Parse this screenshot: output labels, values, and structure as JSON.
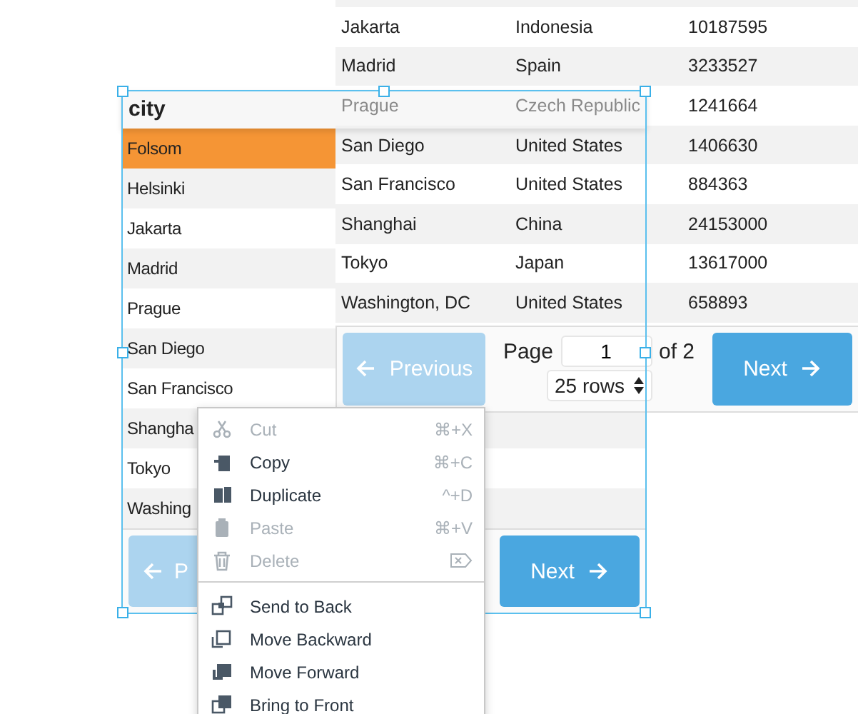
{
  "background_table": {
    "rows": [
      {
        "city": "Jakarta",
        "country": "Indonesia",
        "population": "10187595"
      },
      {
        "city": "Madrid",
        "country": "Spain",
        "population": "3233527"
      },
      {
        "city": "Prague",
        "country": "Czech Republic",
        "population": "1241664"
      },
      {
        "city": "San Diego",
        "country": "United States",
        "population": "1406630"
      },
      {
        "city": "San Francisco",
        "country": "United States",
        "population": "884363"
      },
      {
        "city": "Shanghai",
        "country": "China",
        "population": "24153000"
      },
      {
        "city": "Tokyo",
        "country": "Japan",
        "population": "13617000"
      },
      {
        "city": "Washington, DC",
        "country": "United States",
        "population": "658893"
      }
    ],
    "pagination": {
      "previous": {
        "label": "Previous",
        "disabled": true
      },
      "page_label": "Page",
      "page": "1",
      "of_label": "of 2",
      "rows_select": "25 rows",
      "next": {
        "label": "Next",
        "disabled": false
      }
    }
  },
  "dragged_table": {
    "header": "city",
    "rows": [
      {
        "city": "Folsom",
        "selected": true
      },
      {
        "city": "Helsinki",
        "selected": false
      },
      {
        "city": "Jakarta",
        "selected": false
      },
      {
        "city": "Madrid",
        "selected": false
      },
      {
        "city": "Prague",
        "selected": false
      },
      {
        "city": "San Diego",
        "selected": false
      },
      {
        "city": "San Francisco",
        "selected": false
      },
      {
        "city": "Shangha",
        "selected": false
      },
      {
        "city": "Tokyo",
        "selected": false
      },
      {
        "city": "Washing",
        "selected": false
      }
    ],
    "pagination": {
      "previous": {
        "label": "P",
        "disabled": true
      },
      "next": {
        "label": "Next",
        "disabled": false
      }
    }
  },
  "context_menu": {
    "items": [
      {
        "kind": "item",
        "label": "Cut",
        "disabled": true,
        "shortcut": {
          "kind": "text",
          "text": "⌘+X"
        }
      },
      {
        "kind": "item",
        "label": "Copy",
        "disabled": false,
        "shortcut": {
          "kind": "text",
          "text": "⌘+C"
        }
      },
      {
        "kind": "item",
        "label": "Duplicate",
        "disabled": false,
        "shortcut": {
          "kind": "text",
          "text": "^+D"
        }
      },
      {
        "kind": "item",
        "label": "Paste",
        "disabled": true,
        "shortcut": {
          "kind": "text",
          "text": "⌘+V"
        }
      },
      {
        "kind": "item",
        "label": "Delete",
        "disabled": true,
        "shortcut": {
          "kind": "icon"
        }
      },
      {
        "kind": "separator"
      },
      {
        "kind": "item",
        "label": "Send to Back",
        "disabled": false
      },
      {
        "kind": "item",
        "label": "Move Backward",
        "disabled": false
      },
      {
        "kind": "item",
        "label": "Move Forward",
        "disabled": false
      },
      {
        "kind": "item",
        "label": "Bring to Front",
        "disabled": false
      }
    ]
  }
}
